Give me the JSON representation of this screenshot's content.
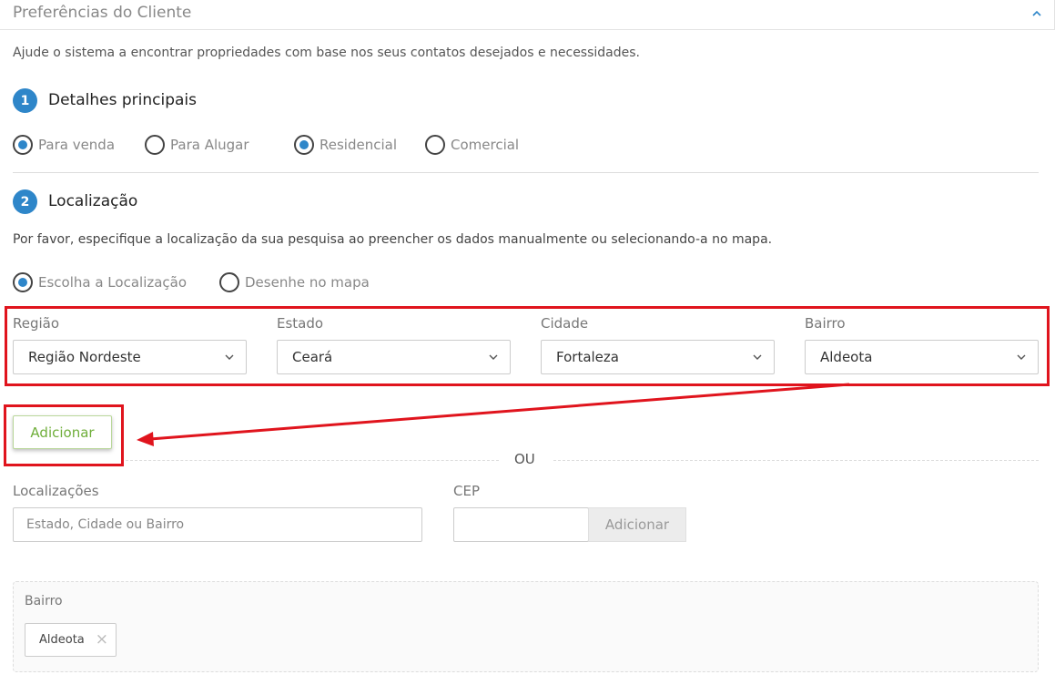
{
  "header": {
    "title": "Preferências do Cliente"
  },
  "intro": "Ajude o sistema a encontrar propriedades com base nos seus contatos desejados e necessidades.",
  "step1": {
    "number": "1",
    "title": "Detalhes principais",
    "options": [
      {
        "label": "Para venda",
        "selected": true
      },
      {
        "label": "Para Alugar",
        "selected": false
      },
      {
        "label": "Residencial",
        "selected": true
      },
      {
        "label": "Comercial",
        "selected": false
      }
    ]
  },
  "step2": {
    "number": "2",
    "title": "Localização",
    "description": "Por favor, especifique a localização da sua pesquisa ao preencher os dados manualmente ou selecionando-a no mapa.",
    "options": [
      {
        "label": "Escolha a Localização",
        "selected": true
      },
      {
        "label": "Desenhe no mapa",
        "selected": false
      }
    ]
  },
  "selects": [
    {
      "label": "Região",
      "value": "Região Nordeste"
    },
    {
      "label": "Estado",
      "value": "Ceará"
    },
    {
      "label": "Cidade",
      "value": "Fortaleza"
    },
    {
      "label": "Bairro",
      "value": "Aldeota"
    }
  ],
  "add_button": "Adicionar",
  "separator": "OU",
  "locations": {
    "label": "Localizações",
    "placeholder": "Estado, Cidade ou Bairro",
    "value": ""
  },
  "cep": {
    "label": "CEP",
    "value": "",
    "button": "Adicionar"
  },
  "tags": {
    "title": "Bairro",
    "items": [
      "Aldeota"
    ]
  },
  "colors": {
    "accent": "#2e86c9",
    "highlight": "#e0141d",
    "add_green": "#6fae3a"
  }
}
